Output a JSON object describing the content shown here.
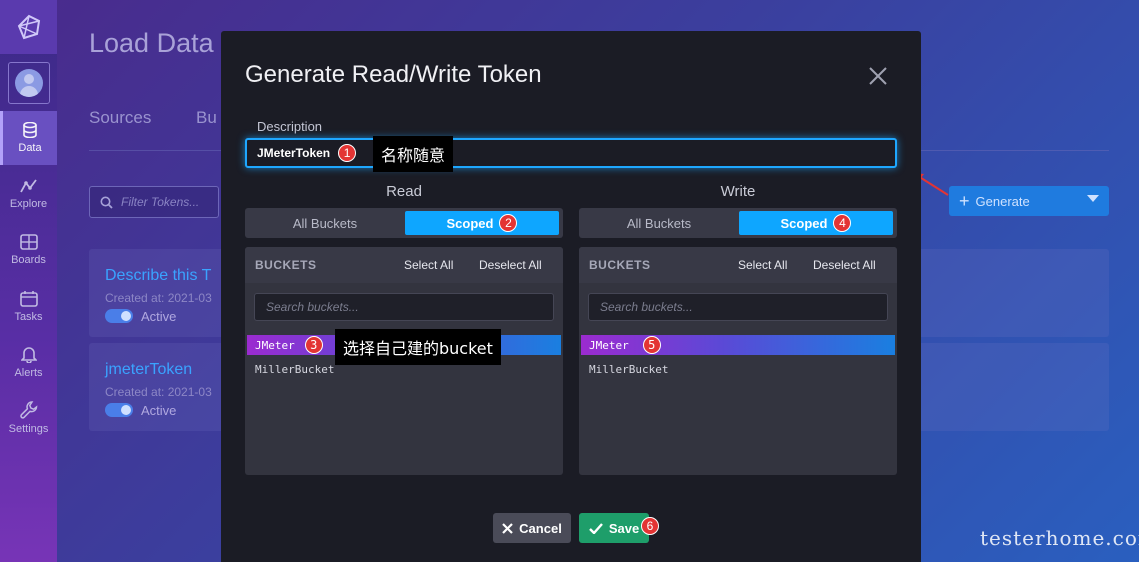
{
  "sidebar": {
    "logo_icon": "influx-logo-icon",
    "items": [
      {
        "label": "Data",
        "icon": "database-icon",
        "active": true
      },
      {
        "label": "Explore",
        "icon": "graph-icon"
      },
      {
        "label": "Boards",
        "icon": "dashboard-icon"
      },
      {
        "label": "Tasks",
        "icon": "calendar-icon"
      },
      {
        "label": "Alerts",
        "icon": "bell-icon"
      },
      {
        "label": "Settings",
        "icon": "wrench-icon"
      }
    ]
  },
  "background": {
    "page_title": "Load Data",
    "tabs": [
      "Sources",
      "Bu"
    ],
    "filter_placeholder": "Filter Tokens...",
    "generate_label": "Generate",
    "tokens": [
      {
        "name": "Describe this T",
        "created": "Created at: 2021-03",
        "status": "Active"
      },
      {
        "name": "jmeterToken",
        "created": "Created at: 2021-03",
        "status": "Active"
      }
    ]
  },
  "modal": {
    "title": "Generate Read/Write Token",
    "description_label": "Description",
    "description_value": "JMeterToken",
    "read": {
      "heading": "Read",
      "all_label": "All Buckets",
      "scoped_label": "Scoped",
      "buckets_label": "BUCKETS",
      "select_all": "Select All",
      "deselect_all": "Deselect All",
      "search_placeholder": "Search buckets...",
      "buckets": [
        "JMeter",
        "MillerBucket"
      ]
    },
    "write": {
      "heading": "Write",
      "all_label": "All Buckets",
      "scoped_label": "Scoped",
      "buckets_label": "BUCKETS",
      "select_all": "Select All",
      "deselect_all": "Deselect All",
      "search_placeholder": "Search buckets...",
      "buckets": [
        "JMeter",
        "MillerBucket"
      ]
    },
    "cancel_label": "Cancel",
    "save_label": "Save"
  },
  "annotations": {
    "badges": [
      "1",
      "2",
      "3",
      "4",
      "5",
      "6"
    ],
    "tip_name": "名称随意",
    "tip_bucket": "选择自己建的bucket"
  },
  "colors": {
    "accent": "#0ea6ff",
    "selected_bucket_start": "#9b2bd0",
    "selected_bucket_end": "#1a7fe0",
    "save": "#1e9e6a",
    "badge": "#e33434"
  },
  "watermark": "testerhome.com"
}
